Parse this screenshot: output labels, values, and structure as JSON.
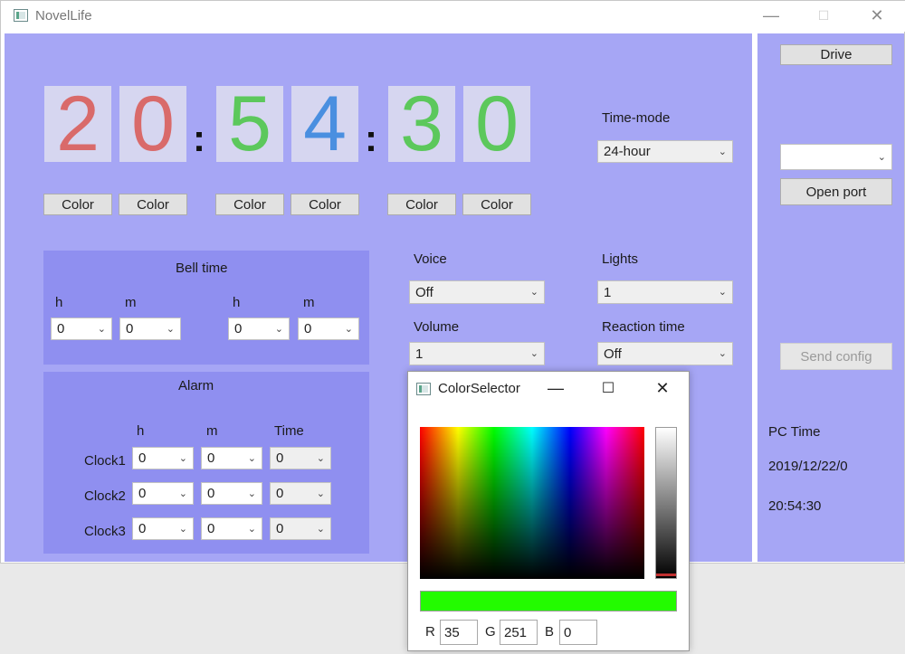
{
  "app": {
    "title": "NovelLife",
    "icon": "app-window-icon"
  },
  "window_controls": {
    "minimize": "—",
    "maximize": "☐",
    "close": "✕"
  },
  "clock": {
    "digits": [
      {
        "value": "2",
        "color": "#d96a6a"
      },
      {
        "value": "0",
        "color": "#d96a6a"
      },
      {
        "value": "5",
        "color": "#5cc85c"
      },
      {
        "value": "4",
        "color": "#4a8fe0"
      },
      {
        "value": "3",
        "color": "#5cc85c"
      },
      {
        "value": "0",
        "color": "#5cc85c"
      }
    ],
    "separator": ":",
    "color_button_label": "Color"
  },
  "time_mode": {
    "label": "Time-mode",
    "value": "24-hour"
  },
  "bell_time": {
    "title": "Bell time",
    "h_label": "h",
    "m_label": "m",
    "h1": "0",
    "m1": "0",
    "h2": "0",
    "m2": "0"
  },
  "alarm": {
    "title": "Alarm",
    "col_h": "h",
    "col_m": "m",
    "col_time": "Time",
    "rows": [
      {
        "label": "Clock1",
        "h": "0",
        "m": "0",
        "time": "0"
      },
      {
        "label": "Clock2",
        "h": "0",
        "m": "0",
        "time": "0"
      },
      {
        "label": "Clock3",
        "h": "0",
        "m": "0",
        "time": "0"
      }
    ]
  },
  "voice": {
    "label": "Voice",
    "value": "Off"
  },
  "lights": {
    "label": "Lights",
    "value": "1"
  },
  "volume": {
    "label": "Volume",
    "value": "1"
  },
  "reaction_time": {
    "label": "Reaction time",
    "value": "Off"
  },
  "right_panel": {
    "drive_label": "Drive",
    "port_value": "",
    "open_port_label": "Open port",
    "send_config_label": "Send config",
    "pc_time_label": "PC Time",
    "pc_date": "2019/12/22/0",
    "pc_time": "20:54:30"
  },
  "color_selector": {
    "title": "ColorSelector",
    "controls": {
      "minimize": "—",
      "maximize": "☐",
      "close": "✕"
    },
    "preview_color": "#23fb00",
    "r_label": "R",
    "r": "35",
    "g_label": "G",
    "g": "251",
    "b_label": "B",
    "b": "0"
  },
  "colors": {
    "panel_bg": "#a6a6f5",
    "group_bg": "#8f8ff0",
    "digit_bg": "#d6d6f0"
  }
}
